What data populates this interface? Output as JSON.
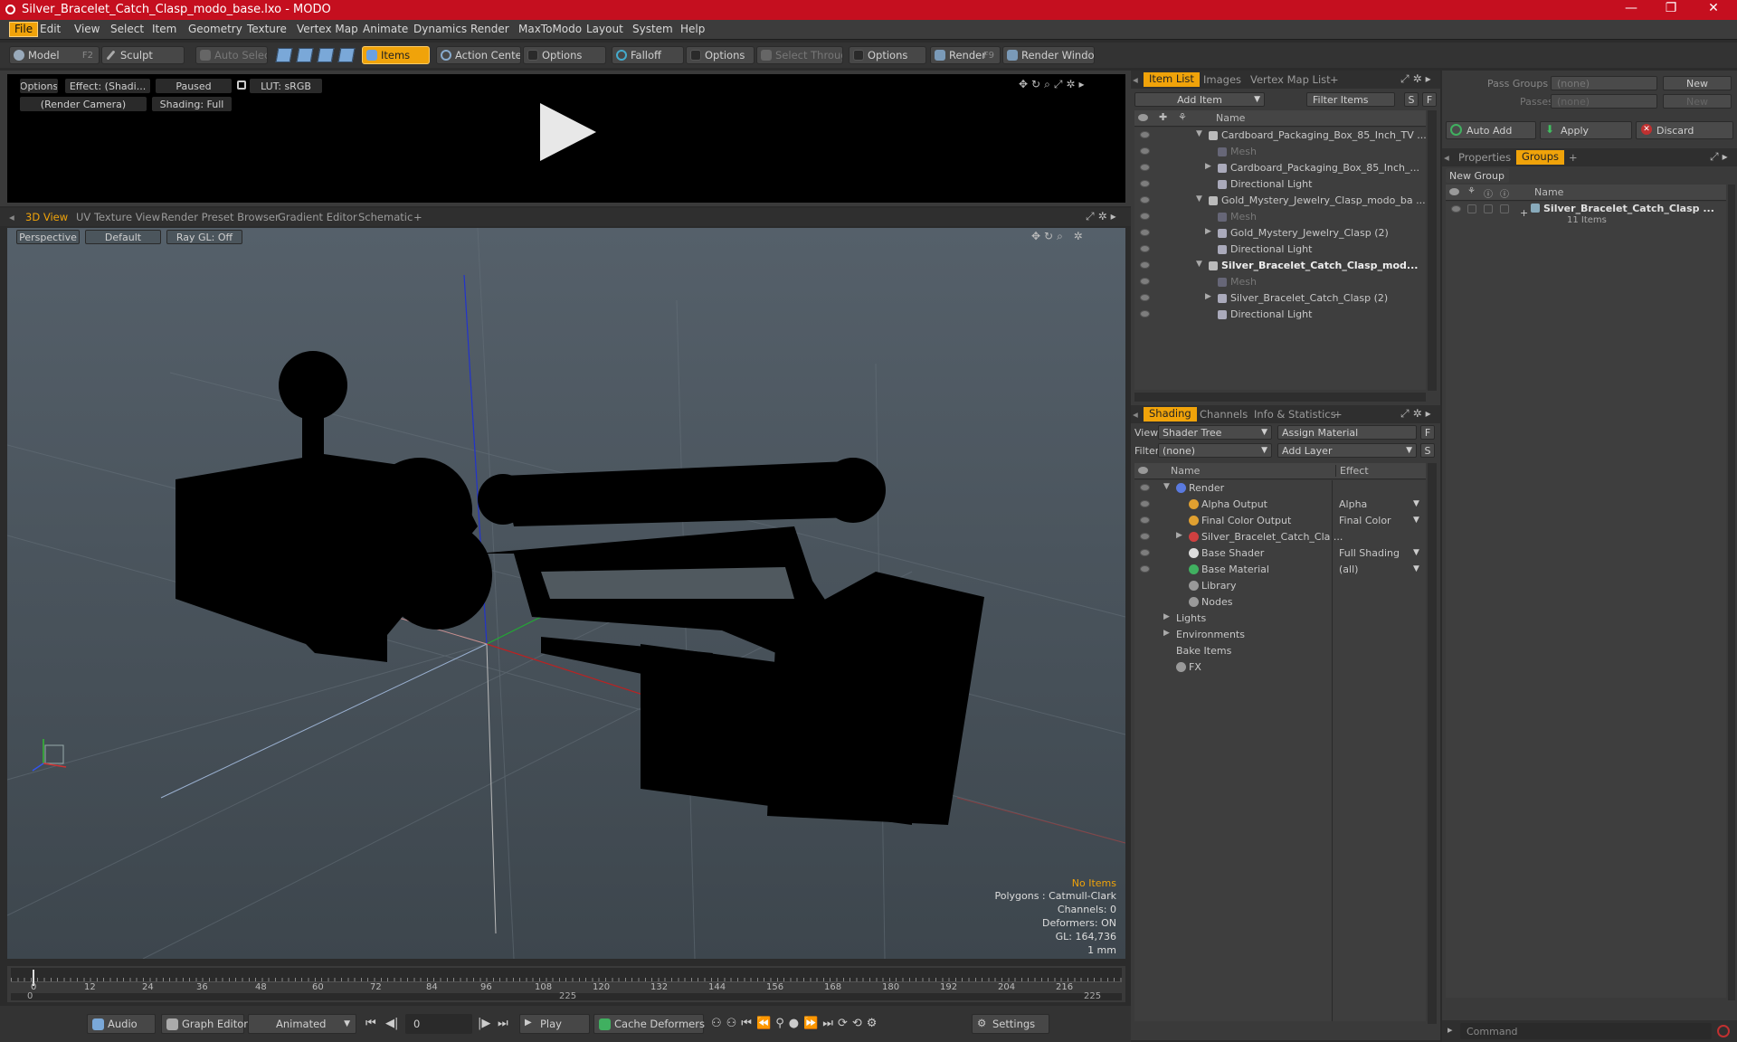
{
  "window": {
    "title": "Silver_Bracelet_Catch_Clasp_modo_base.lxo - MODO",
    "minimize": "—",
    "maximize": "❐",
    "close": "✕"
  },
  "menu": [
    "File",
    "Edit",
    "View",
    "Select",
    "Item",
    "Geometry",
    "Texture",
    "Vertex Map",
    "Animate",
    "Dynamics",
    "Render",
    "MaxToModo",
    "Layout",
    "System",
    "Help"
  ],
  "toolbar": {
    "model": "Model",
    "model_key": "F2",
    "sculpt": "Sculpt",
    "auto_select": "Auto Select",
    "items": "Items",
    "action_center": "Action Center",
    "options1": "Options",
    "falloff": "Falloff",
    "options2": "Options",
    "select_through": "Select Through",
    "options3": "Options",
    "render": "Render",
    "render_key": "F9",
    "render_window": "Render Window"
  },
  "preview": {
    "options": "Options",
    "effect": "Effect: (Shadi...",
    "paused": "Paused",
    "lut": "LUT: sRGB",
    "camera": "(Render Camera)",
    "shading": "Shading: Full"
  },
  "viewport_tabs": [
    "3D View",
    "UV Texture View",
    "Render Preset Browser",
    "Gradient Editor",
    "Schematic"
  ],
  "viewport": {
    "perspective": "Perspective",
    "default": "Default",
    "raygl": "Ray GL: Off",
    "stats": [
      "No Items",
      "Polygons : Catmull-Clark",
      "Channels: 0",
      "Deformers: ON",
      "GL: 164,736",
      "1 mm"
    ]
  },
  "item_panel": {
    "tabs": [
      "Item List",
      "Images",
      "Vertex Map List"
    ],
    "add_item": "Add Item",
    "filter_items": "Filter Items",
    "s": "S",
    "f": "F",
    "col_name": "Name",
    "rows": [
      {
        "name": "Cardboard_Packaging_Box_85_Inch_TV ...",
        "indent": 0,
        "exp": "▼",
        "dim": false,
        "bold": false
      },
      {
        "name": "Mesh",
        "indent": 1,
        "exp": "",
        "dim": true,
        "bold": false
      },
      {
        "name": "Cardboard_Packaging_Box_85_Inch_...",
        "indent": 1,
        "exp": "▶",
        "dim": false,
        "bold": false
      },
      {
        "name": "Directional Light",
        "indent": 1,
        "exp": "",
        "dim": false,
        "bold": false
      },
      {
        "name": "Gold_Mystery_Jewelry_Clasp_modo_ba ...",
        "indent": 0,
        "exp": "▼",
        "dim": false,
        "bold": false
      },
      {
        "name": "Mesh",
        "indent": 1,
        "exp": "",
        "dim": true,
        "bold": false
      },
      {
        "name": "Gold_Mystery_Jewelry_Clasp (2)",
        "indent": 1,
        "exp": "▶",
        "dim": false,
        "bold": false
      },
      {
        "name": "Directional Light",
        "indent": 1,
        "exp": "",
        "dim": false,
        "bold": false
      },
      {
        "name": "Silver_Bracelet_Catch_Clasp_mod...",
        "indent": 0,
        "exp": "▼",
        "dim": false,
        "bold": true
      },
      {
        "name": "Mesh",
        "indent": 1,
        "exp": "",
        "dim": true,
        "bold": false
      },
      {
        "name": "Silver_Bracelet_Catch_Clasp (2)",
        "indent": 1,
        "exp": "▶",
        "dim": false,
        "bold": false
      },
      {
        "name": "Directional Light",
        "indent": 1,
        "exp": "",
        "dim": false,
        "bold": false
      }
    ]
  },
  "shading_panel": {
    "tabs": [
      "Shading",
      "Channels",
      "Info & Statistics"
    ],
    "view_label": "View",
    "view_value": "Shader Tree",
    "assign_material": "Assign Material",
    "filter_label": "Filter",
    "filter_value": "(none)",
    "add_layer": "Add Layer",
    "col_name": "Name",
    "col_effect": "Effect",
    "rows": [
      {
        "name": "Render",
        "effect": "",
        "indent": 0,
        "exp": "▼",
        "color": "#5a7ae0",
        "eye": true
      },
      {
        "name": "Alpha Output",
        "effect": "Alpha",
        "indent": 1,
        "exp": "",
        "color": "#e0a030",
        "eye": true
      },
      {
        "name": "Final Color Output",
        "effect": "Final Color",
        "indent": 1,
        "exp": "",
        "color": "#e0a030",
        "eye": true
      },
      {
        "name": "Silver_Bracelet_Catch_Cla ...",
        "effect": "",
        "indent": 1,
        "exp": "▶",
        "color": "#d04040",
        "eye": true
      },
      {
        "name": "Base Shader",
        "effect": "Full Shading",
        "indent": 1,
        "exp": "",
        "color": "#dddddd",
        "eye": true
      },
      {
        "name": "Base Material",
        "effect": "(all)",
        "indent": 1,
        "exp": "",
        "color": "#40b060",
        "eye": true
      },
      {
        "name": "Library",
        "effect": "",
        "indent": 1,
        "exp": "",
        "color": "#999999",
        "eye": false
      },
      {
        "name": "Nodes",
        "effect": "",
        "indent": 1,
        "exp": "",
        "color": "#999999",
        "eye": false
      },
      {
        "name": "Lights",
        "effect": "",
        "indent": 0,
        "exp": "▶",
        "color": "",
        "eye": false
      },
      {
        "name": "Environments",
        "effect": "",
        "indent": 0,
        "exp": "▶",
        "color": "",
        "eye": false
      },
      {
        "name": "Bake Items",
        "effect": "",
        "indent": 0,
        "exp": "",
        "color": "",
        "eye": false
      },
      {
        "name": "FX",
        "effect": "",
        "indent": 0,
        "exp": "",
        "color": "#999999",
        "eye": false
      }
    ]
  },
  "groups_panel": {
    "pass_groups": "Pass Groups",
    "pass_value": "(none)",
    "new1": "New",
    "passes": "Passes",
    "passes_value": "(none)",
    "new2": "New",
    "auto_add": "Auto Add",
    "apply": "Apply",
    "discard": "Discard",
    "tabs": [
      "Properties",
      "Groups"
    ],
    "new_group": "New Group",
    "col_name": "Name",
    "group_name": "Silver_Bracelet_Catch_Clasp ...",
    "group_count": "11 Items"
  },
  "timeline": {
    "ticks": [
      "0",
      "12",
      "24",
      "36",
      "48",
      "60",
      "72",
      "84",
      "96",
      "108",
      "120",
      "132",
      "144",
      "156",
      "168",
      "180",
      "192",
      "204",
      "216"
    ],
    "start": "0",
    "mid": "225",
    "end": "225"
  },
  "bottom": {
    "audio": "Audio",
    "graph_editor": "Graph Editor",
    "animated": "Animated",
    "frame": "0",
    "play": "Play",
    "cache_deformers": "Cache Deformers",
    "settings": "Settings",
    "command": "Command"
  }
}
